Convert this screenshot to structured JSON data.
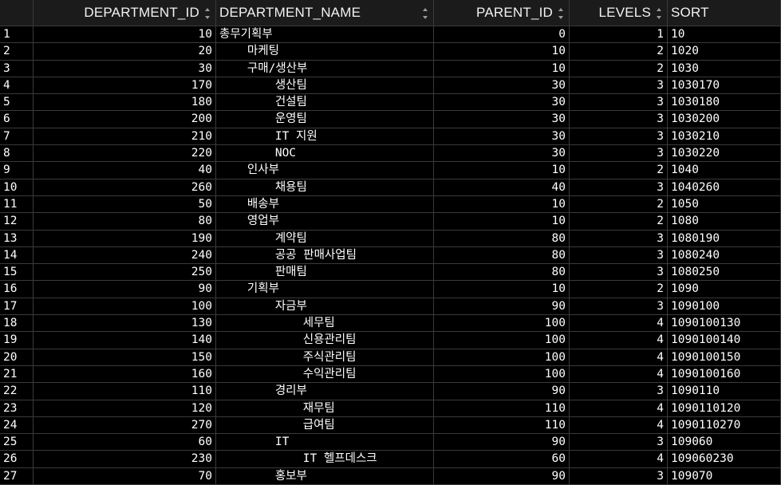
{
  "grid": {
    "columns": [
      {
        "label": "",
        "sortable": false
      },
      {
        "label": "DEPARTMENT_ID",
        "sortable": true
      },
      {
        "label": "DEPARTMENT_NAME",
        "sortable": true
      },
      {
        "label": "PARENT_ID",
        "sortable": true
      },
      {
        "label": "LEVELS",
        "sortable": true
      },
      {
        "label": "SORT",
        "sortable": false
      }
    ],
    "rows": [
      [
        "1",
        "10",
        "총무기획부",
        "0",
        "1",
        "10"
      ],
      [
        "2",
        "20",
        "    마케팅",
        "10",
        "2",
        "1020"
      ],
      [
        "3",
        "30",
        "    구매/생산부",
        "10",
        "2",
        "1030"
      ],
      [
        "4",
        "170",
        "        생산팀",
        "30",
        "3",
        "1030170"
      ],
      [
        "5",
        "180",
        "        건설팀",
        "30",
        "3",
        "1030180"
      ],
      [
        "6",
        "200",
        "        운영팀",
        "30",
        "3",
        "1030200"
      ],
      [
        "7",
        "210",
        "        IT 지원",
        "30",
        "3",
        "1030210"
      ],
      [
        "8",
        "220",
        "        NOC",
        "30",
        "3",
        "1030220"
      ],
      [
        "9",
        "40",
        "    인사부",
        "10",
        "2",
        "1040"
      ],
      [
        "10",
        "260",
        "        채용팀",
        "40",
        "3",
        "1040260"
      ],
      [
        "11",
        "50",
        "    배송부",
        "10",
        "2",
        "1050"
      ],
      [
        "12",
        "80",
        "    영업부",
        "10",
        "2",
        "1080"
      ],
      [
        "13",
        "190",
        "        계약팀",
        "80",
        "3",
        "1080190"
      ],
      [
        "14",
        "240",
        "        공공 판매사업팀",
        "80",
        "3",
        "1080240"
      ],
      [
        "15",
        "250",
        "        판매팀",
        "80",
        "3",
        "1080250"
      ],
      [
        "16",
        "90",
        "    기획부",
        "10",
        "2",
        "1090"
      ],
      [
        "17",
        "100",
        "        자금부",
        "90",
        "3",
        "1090100"
      ],
      [
        "18",
        "130",
        "            세무팀",
        "100",
        "4",
        "1090100130"
      ],
      [
        "19",
        "140",
        "            신용관리팀",
        "100",
        "4",
        "1090100140"
      ],
      [
        "20",
        "150",
        "            주식관리팀",
        "100",
        "4",
        "1090100150"
      ],
      [
        "21",
        "160",
        "            수익관리팀",
        "100",
        "4",
        "1090100160"
      ],
      [
        "22",
        "110",
        "        경리부",
        "90",
        "3",
        "1090110"
      ],
      [
        "23",
        "120",
        "            재무팀",
        "110",
        "4",
        "1090110120"
      ],
      [
        "24",
        "270",
        "            급여팀",
        "110",
        "4",
        "1090110270"
      ],
      [
        "25",
        "60",
        "        IT",
        "90",
        "3",
        "109060"
      ],
      [
        "26",
        "230",
        "            IT 헬프데스크",
        "60",
        "4",
        "109060230"
      ],
      [
        "27",
        "70",
        "        홍보부",
        "90",
        "3",
        "109070"
      ]
    ]
  }
}
